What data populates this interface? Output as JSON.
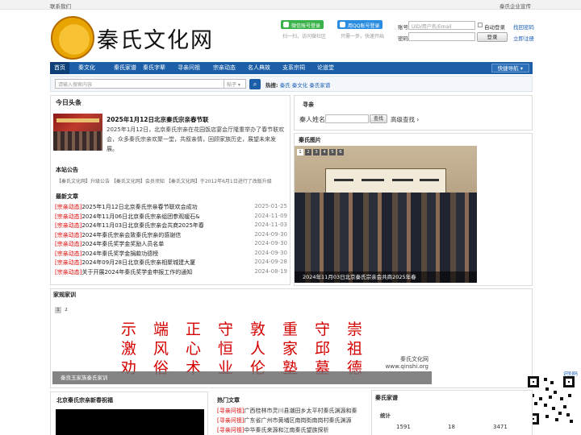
{
  "topbar": {
    "left": "联系我们",
    "right": "秦氏企业宣传"
  },
  "logo": {
    "text": "秦氏文化网"
  },
  "login": {
    "wechat": "微信账号登录",
    "wechat_tip": "扫一扫，访问微社区",
    "qq": "用QQ账号登录",
    "qq_tip": "只需一步，快速开始",
    "account_label": "账号",
    "account_placeholder": "UID/用户名/Email",
    "auto_login": "自动登录",
    "forgot": "找回密码",
    "password_label": "密码",
    "login_button": "登录",
    "register": "立即注册"
  },
  "nav": {
    "items": [
      "首页",
      "秦文化",
      "秦氏家谱",
      "秦氏字辈",
      "寻亲问祖",
      "宗亲动态",
      "名人典故",
      "支系宗祠",
      "论道堂"
    ],
    "quick": "快捷导航 ▾"
  },
  "search": {
    "placeholder": "请输入搜索内容",
    "type": "帖子 ▾",
    "hot_label": "热搜:",
    "hot": [
      "秦氏",
      "秦文化",
      "秦氏家谱"
    ]
  },
  "headline": {
    "section": "今日头条",
    "title": "2025年1月12日北京秦氏宗亲春节联",
    "body": "2025年1月12日，北京秦氏宗亲在花园饭店宴会厅隆重举办了春节联欢会，众多秦氏宗亲欢聚一堂，共叙亲情，回顾家族历史，展望未来发展。"
  },
  "notice": {
    "section": "本站公告",
    "text": "【秦氏文化网】升级公告    【秦氏文化网】会员须知    【秦氏文化网】于2012年6月1日进行了改版升级"
  },
  "latest": {
    "section": "最新文章",
    "rows": [
      {
        "cat": "[宗亲动态]",
        "title": "2025年1月12日北京秦氏宗亲春节联欢会成功",
        "date": "2025-01-25"
      },
      {
        "cat": "[宗亲动态]",
        "title": "2024年11月06日北京秦氏宗亲组团参观瑷石&",
        "date": "2024-11-09"
      },
      {
        "cat": "[宗亲动态]",
        "title": "2024年11月03日北京秦氏宗亲会共商2025年春",
        "date": "2024-11-03"
      },
      {
        "cat": "[宗亲动态]",
        "title": "2024年秦氏宗亲会致秦氏宗亲的感谢信",
        "date": "2024-09-30"
      },
      {
        "cat": "[宗亲动态]",
        "title": "2024年秦氏奖学金奖励人员名单",
        "date": "2024-09-30"
      },
      {
        "cat": "[宗亲动态]",
        "title": "2024年秦氏奖学金捐款功德榜",
        "date": "2024-09-30"
      },
      {
        "cat": "[宗亲动态]",
        "title": "2024年09月28日北京秦氏宗亲相聚城建大厦",
        "date": "2024-09-28"
      },
      {
        "cat": "[宗亲动态]",
        "title": "关于开展2024年秦氏奖学金申报工作的通知",
        "date": "2024-08-19"
      }
    ]
  },
  "xunqin": {
    "section": "寻亲",
    "name_label": "秦人姓名",
    "search_btn": "查找",
    "advanced": "高级查找 ›"
  },
  "photos": {
    "section": "秦氏图片",
    "pages": [
      "1",
      "2",
      "3",
      "4",
      "5",
      "6"
    ],
    "caption": "2024年11月03日北京秦氏宗亲会共商2025年春"
  },
  "jiagui": {
    "section": "家规家训",
    "pages": [
      "1",
      "2"
    ],
    "lines": [
      "示端正守敦重守崇",
      "激风心恒人家邱祖",
      "劝俗术业伦塾墓德"
    ],
    "caption": "秦良玉家族秦氏家训",
    "site_name": "秦氏文化网",
    "site_url": "www.qinshi.org"
  },
  "bottom": {
    "newyear": "北京秦氏宗亲新春祝福",
    "hot_section": "热门文章",
    "hot_rows": [
      {
        "cat": "[寻亲问祖]",
        "title": "广西桂林市灵川县潮田乡太平村秦氏渊源和秦"
      },
      {
        "cat": "[寻亲问祖]",
        "title": "广东省广州市黄埔区南岗街南岗村秦氏渊源"
      },
      {
        "cat": "[寻亲问祖]",
        "title": "中华秦氏来源和江南秦氏望族探析"
      }
    ],
    "jiapu_section": "秦氏家谱",
    "stats_label": "统计",
    "stats": [
      "1591",
      "18",
      "3471"
    ],
    "qr_label": "识别码"
  }
}
